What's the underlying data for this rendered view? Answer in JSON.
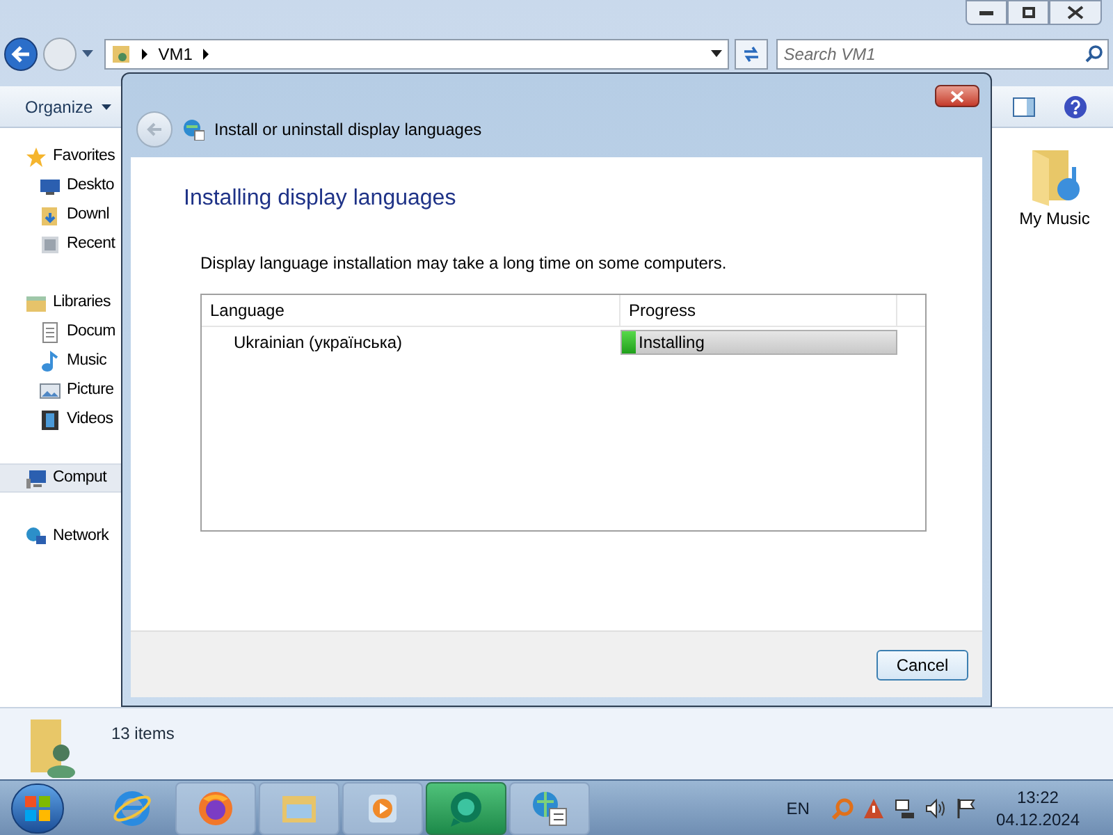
{
  "explorer": {
    "address": {
      "segments": [
        "VM1"
      ]
    },
    "search": {
      "placeholder": "Search VM1"
    },
    "toolbar": {
      "organize": "Organize"
    },
    "nav": [
      {
        "label": "Favorites",
        "kind": "group"
      },
      {
        "label": "Deskto",
        "kind": "item"
      },
      {
        "label": "Downl",
        "kind": "item"
      },
      {
        "label": "Recent",
        "kind": "item"
      },
      {
        "label": "Libraries",
        "kind": "group"
      },
      {
        "label": "Docum",
        "kind": "item"
      },
      {
        "label": "Music",
        "kind": "item"
      },
      {
        "label": "Picture",
        "kind": "item"
      },
      {
        "label": "Videos",
        "kind": "item"
      },
      {
        "label": "Comput",
        "kind": "group",
        "selected": true
      },
      {
        "label": "Network",
        "kind": "group",
        "selected": false
      }
    ],
    "files": [
      {
        "label": "My Music"
      }
    ],
    "status": "13 items"
  },
  "dialog": {
    "title": "Install or uninstall display languages",
    "heading": "Installing display languages",
    "note": "Display language installation may take a long time on some computers.",
    "table": {
      "columns": [
        "Language",
        "Progress"
      ],
      "rows": [
        {
          "language": "Ukrainian (українська)",
          "status": "Installing",
          "level": 0.05
        }
      ]
    },
    "cancel": "Cancel"
  },
  "taskbar": {
    "apps": [
      {
        "active": false
      },
      {
        "active": false
      },
      {
        "active": false
      },
      {
        "active": false
      },
      {
        "active": true
      },
      {
        "active": false
      }
    ],
    "tray": {
      "lang": "EN",
      "time": "13:22",
      "date": "04.12.2024"
    }
  }
}
